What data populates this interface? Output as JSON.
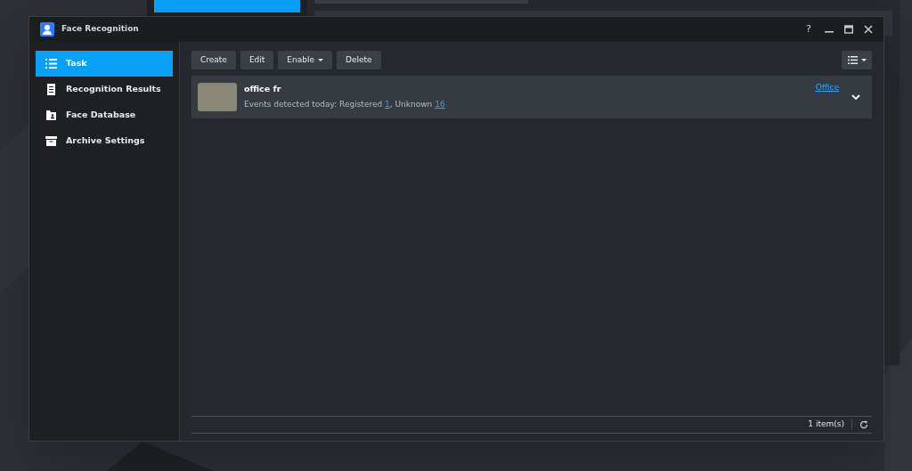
{
  "background_window": {
    "sidebar_item": {
      "selected": true
    }
  },
  "window": {
    "title": "Face Recognition",
    "help": "?"
  },
  "sidebar": {
    "items": [
      {
        "label": "Task",
        "kind": "list",
        "selected": true
      },
      {
        "label": "Recognition Results",
        "kind": "document",
        "selected": false
      },
      {
        "label": "Face Database",
        "kind": "folder",
        "selected": false
      },
      {
        "label": "Archive Settings",
        "kind": "archive",
        "selected": false
      }
    ]
  },
  "toolbar": {
    "buttons": [
      {
        "label": "Create",
        "kind": "button"
      },
      {
        "label": "Edit",
        "kind": "button"
      },
      {
        "label": "Enable",
        "kind": "dropdown"
      },
      {
        "label": "Delete",
        "kind": "button"
      }
    ]
  },
  "tasks": [
    {
      "name": "office fr",
      "events_prefix": "Events detected today: Registered ",
      "registered": "1",
      "separator": ", Unknown ",
      "unknown": "16",
      "location": "Office",
      "expanded": false
    }
  ],
  "status_bar": {
    "count": "1 item(s)"
  }
}
